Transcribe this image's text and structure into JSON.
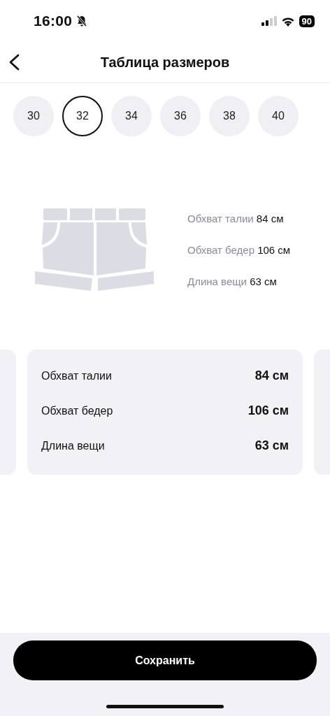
{
  "status_bar": {
    "time": "16:00",
    "battery": "90"
  },
  "header": {
    "title": "Таблица размеров"
  },
  "sizes": [
    {
      "label": "30",
      "selected": false
    },
    {
      "label": "32",
      "selected": true
    },
    {
      "label": "34",
      "selected": false
    },
    {
      "label": "36",
      "selected": false
    },
    {
      "label": "38",
      "selected": false
    },
    {
      "label": "40",
      "selected": false
    }
  ],
  "diagram_measurements": [
    {
      "label": "Обхват талии",
      "value": "84 см"
    },
    {
      "label": "Обхват бедер",
      "value": "106 см"
    },
    {
      "label": "Длина вещи",
      "value": "63 см"
    }
  ],
  "cards": [
    {
      "kind": "partial_left"
    },
    {
      "kind": "full",
      "rows": [
        {
          "label": "Обхват талии",
          "value": "84 см"
        },
        {
          "label": "Обхват бедер",
          "value": "106 см"
        },
        {
          "label": "Длина вещи",
          "value": "63 см"
        }
      ]
    },
    {
      "kind": "partial_right"
    }
  ],
  "save_button": {
    "label": "Сохранить"
  }
}
